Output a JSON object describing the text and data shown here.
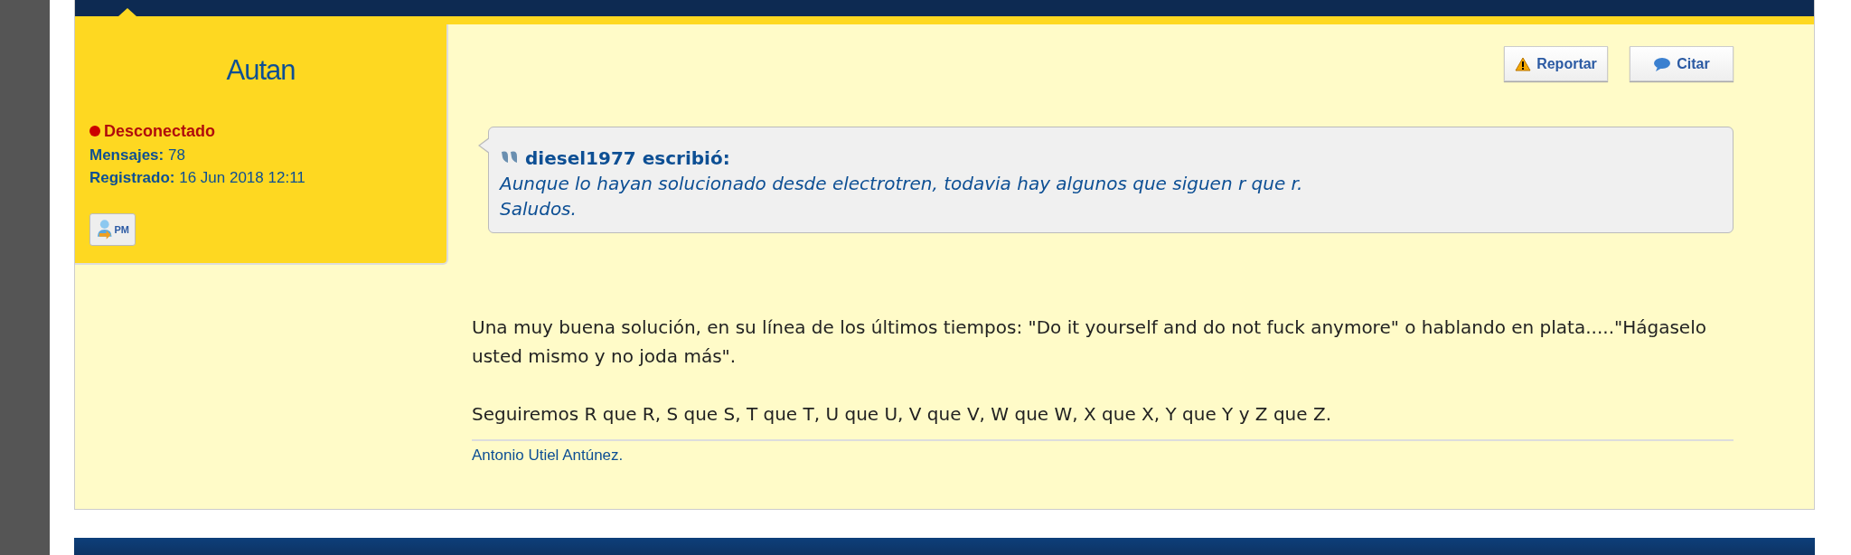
{
  "author": {
    "name": "Autan",
    "status": "Desconectado",
    "online": false,
    "stats": [
      {
        "label": "Mensajes:",
        "value": "78"
      },
      {
        "label": "Registrado:",
        "value": "16 Jun 2018 12:11"
      }
    ],
    "pm_label": "PM"
  },
  "buttons": [
    {
      "kind": "report",
      "label": "Reportar"
    },
    {
      "kind": "quote",
      "label": "Citar"
    }
  ],
  "quote": {
    "author": "diesel1977 escribió:",
    "lines": [
      "Aunque lo hayan solucionado desde electrotren, todavia hay algunos que siguen r que r.",
      "Saludos."
    ]
  },
  "paragraphs": [
    "Una muy buena solución, en su línea de los últimos tiempos: \"Do it yourself and do not fuck anymore\" o hablando en plata.....\"Hágaselo usted mismo y no joda más\".",
    "Seguiremos R que R, S que S, T que T, U que U, V que V, W que W, X que X, Y que Y y Z que Z."
  ],
  "signature": "Antonio Utiel Antúnez."
}
